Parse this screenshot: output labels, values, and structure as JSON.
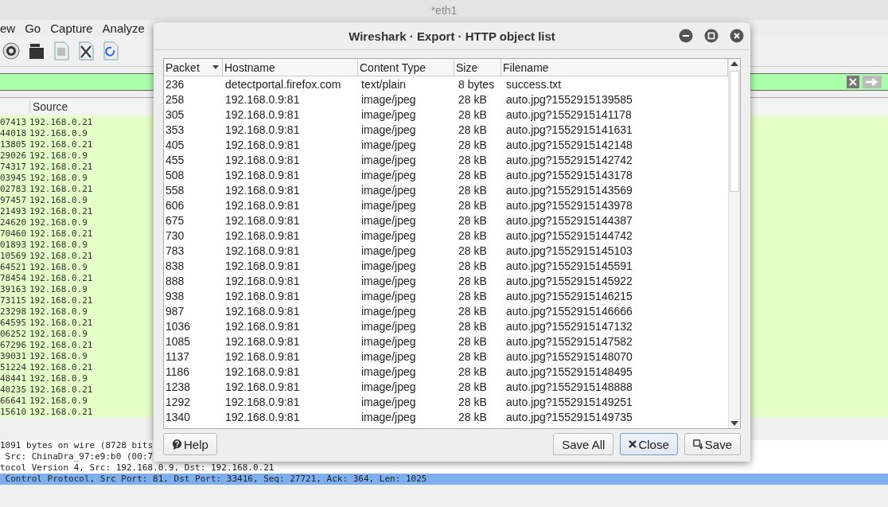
{
  "main_window": {
    "title": "*eth1",
    "menu": [
      "ew",
      "Go",
      "Capture",
      "Analyze"
    ],
    "packet_list": {
      "columns": [
        "Source"
      ],
      "rows": [
        {
          "column_1": "07413",
          "source": "192.168.0.21"
        },
        {
          "column_1": "44018",
          "source": "192.168.0.9"
        },
        {
          "column_1": "13805",
          "source": "192.168.0.21"
        },
        {
          "column_1": "29026",
          "source": "192.168.0.9"
        },
        {
          "column_1": "74317",
          "source": "192.168.0.21"
        },
        {
          "column_1": "03945",
          "source": "192.168.0.9"
        },
        {
          "column_1": "02783",
          "source": "192.168.0.21"
        },
        {
          "column_1": "97457",
          "source": "192.168.0.9"
        },
        {
          "column_1": "21493",
          "source": "192.168.0.21"
        },
        {
          "column_1": "24620",
          "source": "192.168.0.9"
        },
        {
          "column_1": "70460",
          "source": "192.168.0.21"
        },
        {
          "column_1": "01893",
          "source": "192.168.0.9"
        },
        {
          "column_1": "10569",
          "source": "192.168.0.21"
        },
        {
          "column_1": "64521",
          "source": "192.168.0.9"
        },
        {
          "column_1": "78454",
          "source": "192.168.0.21"
        },
        {
          "column_1": "39163",
          "source": "192.168.0.9"
        },
        {
          "column_1": "73115",
          "source": "192.168.0.21"
        },
        {
          "column_1": "23298",
          "source": "192.168.0.9"
        },
        {
          "column_1": "64595",
          "source": "192.168.0.21"
        },
        {
          "column_1": "06252",
          "source": "192.168.0.9"
        },
        {
          "column_1": "67296",
          "source": "192.168.0.21"
        },
        {
          "column_1": "39031",
          "source": "192.168.0.9"
        },
        {
          "column_1": "51224",
          "source": "192.168.0.21"
        },
        {
          "column_1": "48441",
          "source": "192.168.0.9"
        },
        {
          "column_1": "40235",
          "source": "192.168.0.21"
        },
        {
          "column_1": "66641",
          "source": "192.168.0.9"
        },
        {
          "column_1": "15610",
          "source": "192.168.0.21"
        }
      ]
    },
    "details": [
      {
        "text": "1091 bytes on wire (8728 bits",
        "selected": false
      },
      {
        "text": " Src: ChinaDra_97:e9:b0 (00:7",
        "selected": false
      },
      {
        "text": "tocol Version 4, Src: 192.168.0.9, Dst: 192.168.0.21",
        "selected": false
      },
      {
        "text": " Control Protocol, Src Port: 81, Dst Port: 33416, Seq: 27721, Ack: 364, Len: 1025",
        "selected": true
      }
    ]
  },
  "dialog": {
    "title": "Wireshark · Export · HTTP object list",
    "columns": [
      "Packet",
      "Hostname",
      "Content Type",
      "Size",
      "Filename"
    ],
    "rows": [
      [
        "236",
        "detectportal.firefox.com",
        "text/plain",
        "8 bytes",
        "success.txt"
      ],
      [
        "258",
        "192.168.0.9:81",
        "image/jpeg",
        "28 kB",
        "auto.jpg?1552915139585"
      ],
      [
        "305",
        "192.168.0.9:81",
        "image/jpeg",
        "28 kB",
        "auto.jpg?1552915141178"
      ],
      [
        "353",
        "192.168.0.9:81",
        "image/jpeg",
        "28 kB",
        "auto.jpg?1552915141631"
      ],
      [
        "405",
        "192.168.0.9:81",
        "image/jpeg",
        "28 kB",
        "auto.jpg?1552915142148"
      ],
      [
        "455",
        "192.168.0.9:81",
        "image/jpeg",
        "28 kB",
        "auto.jpg?1552915142742"
      ],
      [
        "508",
        "192.168.0.9:81",
        "image/jpeg",
        "28 kB",
        "auto.jpg?1552915143178"
      ],
      [
        "558",
        "192.168.0.9:81",
        "image/jpeg",
        "28 kB",
        "auto.jpg?1552915143569"
      ],
      [
        "606",
        "192.168.0.9:81",
        "image/jpeg",
        "28 kB",
        "auto.jpg?1552915143978"
      ],
      [
        "675",
        "192.168.0.9:81",
        "image/jpeg",
        "28 kB",
        "auto.jpg?1552915144387"
      ],
      [
        "730",
        "192.168.0.9:81",
        "image/jpeg",
        "28 kB",
        "auto.jpg?1552915144742"
      ],
      [
        "783",
        "192.168.0.9:81",
        "image/jpeg",
        "28 kB",
        "auto.jpg?1552915145103"
      ],
      [
        "838",
        "192.168.0.9:81",
        "image/jpeg",
        "28 kB",
        "auto.jpg?1552915145591"
      ],
      [
        "888",
        "192.168.0.9:81",
        "image/jpeg",
        "28 kB",
        "auto.jpg?1552915145922"
      ],
      [
        "938",
        "192.168.0.9:81",
        "image/jpeg",
        "28 kB",
        "auto.jpg?1552915146215"
      ],
      [
        "987",
        "192.168.0.9:81",
        "image/jpeg",
        "28 kB",
        "auto.jpg?1552915146666"
      ],
      [
        "1036",
        "192.168.0.9:81",
        "image/jpeg",
        "28 kB",
        "auto.jpg?1552915147132"
      ],
      [
        "1085",
        "192.168.0.9:81",
        "image/jpeg",
        "28 kB",
        "auto.jpg?1552915147582"
      ],
      [
        "1137",
        "192.168.0.9:81",
        "image/jpeg",
        "28 kB",
        "auto.jpg?1552915148070"
      ],
      [
        "1186",
        "192.168.0.9:81",
        "image/jpeg",
        "28 kB",
        "auto.jpg?1552915148495"
      ],
      [
        "1238",
        "192.168.0.9:81",
        "image/jpeg",
        "28 kB",
        "auto.jpg?1552915148888"
      ],
      [
        "1292",
        "192.168.0.9:81",
        "image/jpeg",
        "28 kB",
        "auto.jpg?1552915149251"
      ],
      [
        "1340",
        "192.168.0.9:81",
        "image/jpeg",
        "28 kB",
        "auto.jpg?1552915149735"
      ]
    ],
    "buttons": {
      "help": "Help",
      "save_all": "Save All",
      "close": "Close",
      "save": "Save"
    }
  }
}
